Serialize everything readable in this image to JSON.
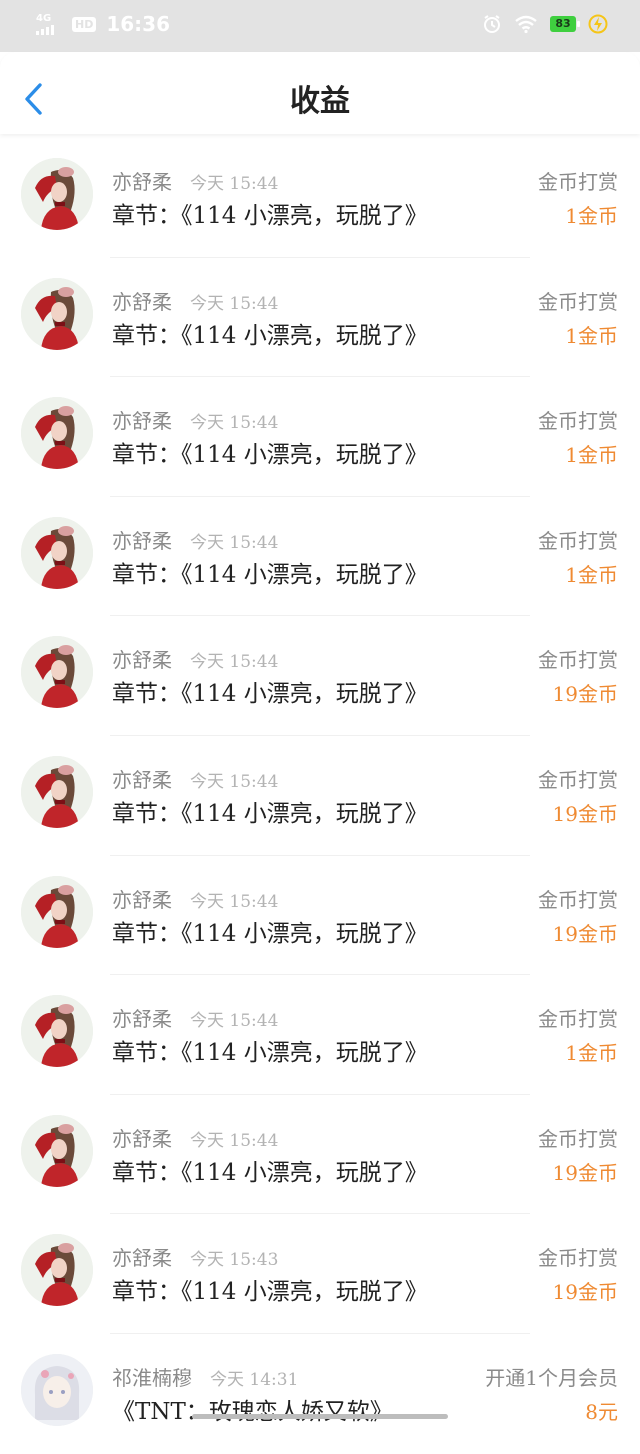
{
  "status_bar": {
    "network": "4G",
    "hd": "HD",
    "time": "16:36",
    "battery": "83"
  },
  "header": {
    "title": "收益"
  },
  "colors": {
    "accent_back": "#2b8de8",
    "amount": "#ef8a32"
  },
  "items": [
    {
      "name": "亦舒柔",
      "time": "今天 15:44",
      "chapter": "章节：《114 小漂亮，玩脱了》",
      "type": "金币打赏",
      "amount": "1金币",
      "avatar": "red-girl"
    },
    {
      "name": "亦舒柔",
      "time": "今天 15:44",
      "chapter": "章节：《114 小漂亮，玩脱了》",
      "type": "金币打赏",
      "amount": "1金币",
      "avatar": "red-girl"
    },
    {
      "name": "亦舒柔",
      "time": "今天 15:44",
      "chapter": "章节：《114 小漂亮，玩脱了》",
      "type": "金币打赏",
      "amount": "1金币",
      "avatar": "red-girl"
    },
    {
      "name": "亦舒柔",
      "time": "今天 15:44",
      "chapter": "章节：《114 小漂亮，玩脱了》",
      "type": "金币打赏",
      "amount": "1金币",
      "avatar": "red-girl"
    },
    {
      "name": "亦舒柔",
      "time": "今天 15:44",
      "chapter": "章节：《114 小漂亮，玩脱了》",
      "type": "金币打赏",
      "amount": "19金币",
      "avatar": "red-girl"
    },
    {
      "name": "亦舒柔",
      "time": "今天 15:44",
      "chapter": "章节：《114 小漂亮，玩脱了》",
      "type": "金币打赏",
      "amount": "19金币",
      "avatar": "red-girl"
    },
    {
      "name": "亦舒柔",
      "time": "今天 15:44",
      "chapter": "章节：《114 小漂亮，玩脱了》",
      "type": "金币打赏",
      "amount": "19金币",
      "avatar": "red-girl"
    },
    {
      "name": "亦舒柔",
      "time": "今天 15:44",
      "chapter": "章节：《114 小漂亮，玩脱了》",
      "type": "金币打赏",
      "amount": "1金币",
      "avatar": "red-girl"
    },
    {
      "name": "亦舒柔",
      "time": "今天 15:44",
      "chapter": "章节：《114 小漂亮，玩脱了》",
      "type": "金币打赏",
      "amount": "19金币",
      "avatar": "red-girl"
    },
    {
      "name": "亦舒柔",
      "time": "今天 15:43",
      "chapter": "章节：《114 小漂亮，玩脱了》",
      "type": "金币打赏",
      "amount": "19金币",
      "avatar": "red-girl"
    },
    {
      "name": "祁淮楠穆",
      "time": "今天 14:31",
      "chapter": "《TNT：玫瑰恋人娇又软》",
      "type": "开通1个月会员",
      "amount": "8元",
      "avatar": "pale-girl"
    }
  ]
}
